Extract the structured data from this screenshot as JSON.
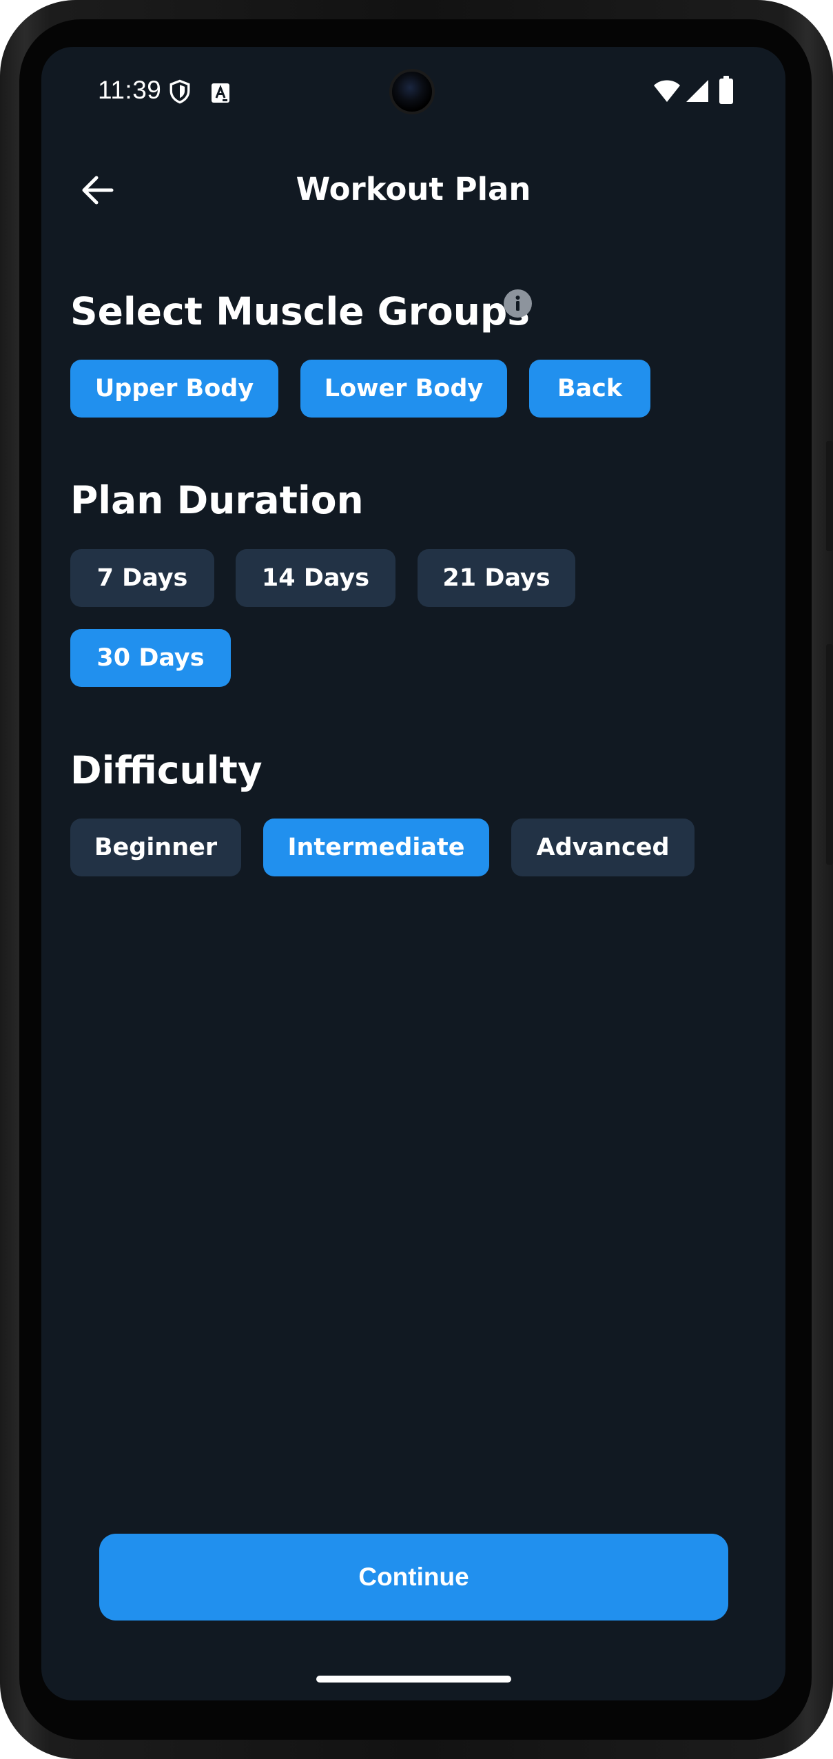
{
  "status_bar": {
    "time": "11:39",
    "icons": [
      "shield-icon",
      "text-notification-icon",
      "wifi-icon",
      "cellular-signal-icon",
      "battery-icon"
    ]
  },
  "header": {
    "title": "Workout Plan",
    "back_icon": "arrow-left-icon"
  },
  "muscle_groups": {
    "title": "Select Muscle Groups",
    "info_icon": "info-icon",
    "options": [
      {
        "label": "Upper Body",
        "selected": true
      },
      {
        "label": "Lower Body",
        "selected": true
      },
      {
        "label": "Back",
        "selected": true
      }
    ]
  },
  "duration": {
    "title": "Plan Duration",
    "options": [
      {
        "label": "7 Days",
        "selected": false
      },
      {
        "label": "14 Days",
        "selected": false
      },
      {
        "label": "21 Days",
        "selected": false
      },
      {
        "label": "30 Days",
        "selected": true
      }
    ]
  },
  "difficulty": {
    "title": "Difficulty",
    "options": [
      {
        "label": "Beginner",
        "selected": false
      },
      {
        "label": "Intermediate",
        "selected": true
      },
      {
        "label": "Advanced",
        "selected": false
      }
    ]
  },
  "footer": {
    "continue_label": "Continue"
  },
  "colors": {
    "background": "#111922",
    "accent": "#2190ee",
    "chip_unselected": "#223245"
  }
}
